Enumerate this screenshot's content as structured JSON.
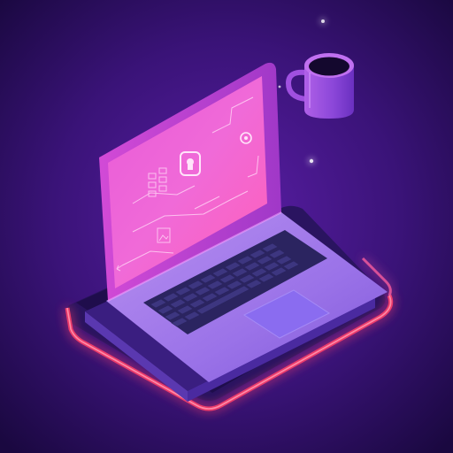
{
  "scene": {
    "background": {
      "glow_color": "#5a1ea6",
      "edge_color": "#1a0840"
    },
    "palette": {
      "neon_pink": "#ff3fa0",
      "neon_orange": "#ff6a3a",
      "magenta": "#e040c8",
      "violet": "#7b4dd8",
      "screen_pink": "#f06ad8",
      "keyboard_key": "#2b2460",
      "trackpad": "#8a6cf0"
    },
    "objects": [
      {
        "name": "laptop",
        "icon": "laptop-icon"
      },
      {
        "name": "coffee-mug",
        "icon": "mug-icon"
      },
      {
        "name": "neon-platform",
        "icon": "platform-icon"
      },
      {
        "name": "sparkles",
        "icon": "sparkle-icon"
      }
    ],
    "screen_icons": [
      "shield-lock-icon",
      "location-pin-icon",
      "grid-icon",
      "image-icon",
      "arrow-icon"
    ]
  }
}
